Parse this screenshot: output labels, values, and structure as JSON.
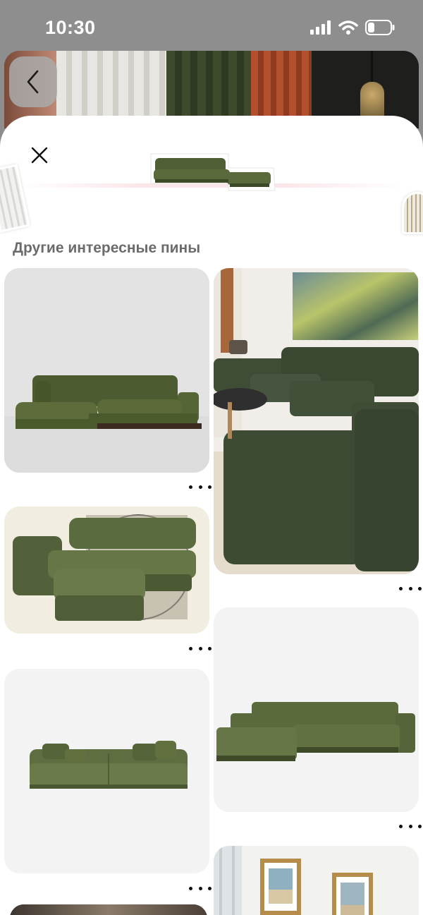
{
  "status_bar": {
    "time": "10:30",
    "icons": [
      "signal-icon",
      "wifi-icon",
      "battery-icon"
    ]
  },
  "header": {
    "back_icon": "chevron-left-icon",
    "close_icon": "close-icon"
  },
  "section": {
    "title": "Другие интересные пины"
  },
  "pins": [
    {
      "id": "pin-1",
      "subject": "green velvet corner sofa on grey background",
      "more_icon": "more-dots-icon"
    },
    {
      "id": "pin-2",
      "subject": "dark green modular sofa in living room with painting",
      "more_icon": "more-dots-icon"
    },
    {
      "id": "pin-3",
      "subject": "green modular sofa with ottoman on cream background",
      "more_icon": "more-dots-icon"
    },
    {
      "id": "pin-4",
      "subject": "green chaise sofa on light grey background",
      "more_icon": "more-dots-icon"
    },
    {
      "id": "pin-5",
      "subject": "olive green three-seat sofa with pillows",
      "more_icon": "more-dots-icon"
    },
    {
      "id": "pin-6",
      "subject": "living room with framed beach pictures",
      "more_icon": "more-dots-icon"
    }
  ],
  "colors": {
    "sofa_green": "#56653a",
    "sofa_dark": "#3c4a30",
    "title_grey": "#6b6b6b"
  }
}
